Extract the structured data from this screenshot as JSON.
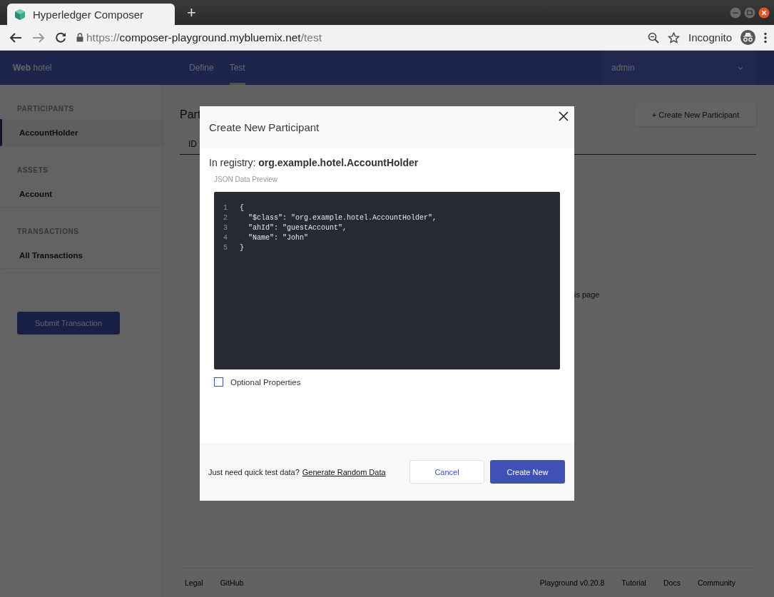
{
  "browser": {
    "tab": {
      "title": "Hyperledger Composer"
    },
    "new_tab": "+",
    "url": {
      "scheme": "https://",
      "host": "composer-playground.mybluemix.net",
      "path": "/test"
    },
    "profile": "Incognito"
  },
  "app": {
    "brand": "**Web** hotel",
    "nav": [
      {
        "label": "Define",
        "selected": false
      },
      {
        "label": "Test",
        "selected": true
      }
    ],
    "user": "admin"
  },
  "sidebar": {
    "sections": [
      {
        "heading": "PARTICIPANTS",
        "items": [
          {
            "label": "AccountHolder",
            "selected": true
          }
        ]
      },
      {
        "heading": "ASSETS",
        "items": [
          {
            "label": "Account",
            "selected": false
          }
        ]
      },
      {
        "heading": "TRANSACTIONS",
        "items": [
          {
            "label": "All Transactions",
            "selected": false
          }
        ]
      }
    ],
    "submit_button": "Submit Transaction"
  },
  "main": {
    "title": "Part",
    "create_button": "+ Create New Participant",
    "column_1": "ID",
    "empty_text": "is page"
  },
  "footer": {
    "left": [
      "Legal",
      "GitHub"
    ],
    "right": [
      "Playground v0.20.8",
      "Tutorial",
      "Docs",
      "Community"
    ]
  },
  "dialog": {
    "title": "Create New Participant",
    "registry": "In registry: **org.example.hotel.AccountHolder**",
    "preview_label": "JSON Data Preview",
    "code": [
      {
        "number": "1",
        "text": "{"
      },
      {
        "number": "2",
        "text": "  \"$class\": \"org.example.hotel.AccountHolder\","
      },
      {
        "number": "3",
        "text": "  \"ahId\": \"guestAccount\","
      },
      {
        "number": "4",
        "text": "  \"Name\": \"John\""
      },
      {
        "number": "5",
        "text": "}"
      }
    ],
    "checkbox": {
      "label": "Optional Properties",
      "checked": false
    },
    "hint": "Just need quick test data?",
    "link": "Generate Random Data",
    "cancel_button": "Cancel",
    "create_button": "Create New"
  }
}
